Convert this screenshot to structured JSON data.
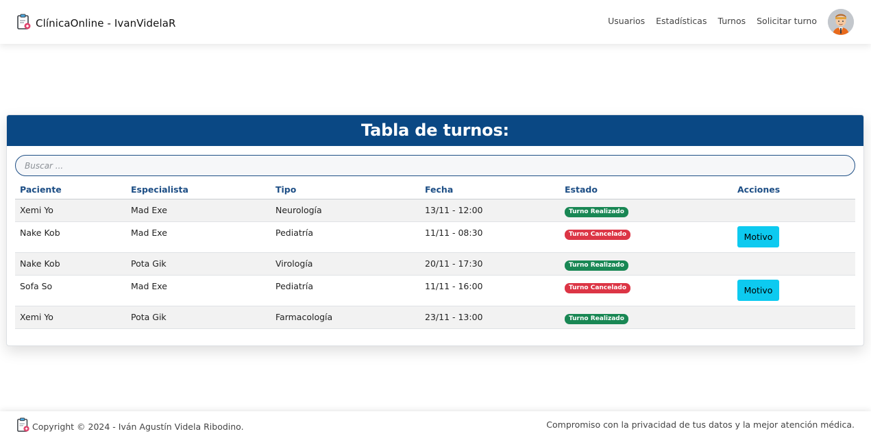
{
  "header": {
    "brand": "ClínicaOnline - IvanVidelaR",
    "nav": [
      "Usuarios",
      "Estadísticas",
      "Turnos",
      "Solicitar turno"
    ]
  },
  "card": {
    "title": "Tabla de turnos:",
    "search_placeholder": "Buscar ...",
    "columns": [
      "Paciente",
      "Especialista",
      "Tipo",
      "Fecha",
      "Estado",
      "Acciones"
    ],
    "rows": [
      {
        "paciente": "Xemi Yo",
        "especialista": "Mad Exe",
        "tipo": "Neurología",
        "fecha": "13/11 - 12:00",
        "estado": "Turno Realizado",
        "accion": ""
      },
      {
        "paciente": "Nake Kob",
        "especialista": "Mad Exe",
        "tipo": "Pediatría",
        "fecha": "11/11 - 08:30",
        "estado": "Turno Cancelado",
        "accion": "Motivo"
      },
      {
        "paciente": "Nake Kob",
        "especialista": "Pota Gik",
        "tipo": "Virología",
        "fecha": "20/11 - 17:30",
        "estado": "Turno Realizado",
        "accion": ""
      },
      {
        "paciente": "Sofa So",
        "especialista": "Mad Exe",
        "tipo": "Pediatría",
        "fecha": "11/11 - 16:00",
        "estado": "Turno Cancelado",
        "accion": "Motivo"
      },
      {
        "paciente": "Xemi Yo",
        "especialista": "Pota Gik",
        "tipo": "Farmacología",
        "fecha": "23/11 - 13:00",
        "estado": "Turno Realizado",
        "accion": ""
      }
    ]
  },
  "footer": {
    "copyright": "Copyright © 2024 - Iván Agustín Videla Ribodino.",
    "tagline": "Compromiso con la privacidad de tus datos y la mejor atención médica."
  },
  "colors": {
    "primary": "#0a4884",
    "success": "#198754",
    "danger": "#dc3545",
    "info": "#0dcaf0"
  },
  "icons": {
    "brand": "clipboard-health-icon",
    "avatar": "user-avatar"
  }
}
